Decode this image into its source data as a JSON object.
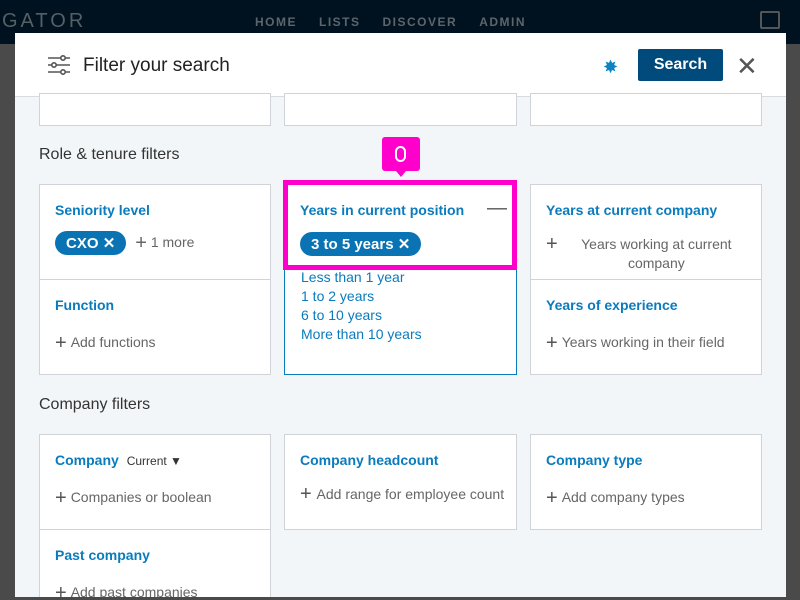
{
  "nav": {
    "brand": "GATOR",
    "links": [
      "HOME",
      "LISTS",
      "DISCOVER",
      "ADMIN"
    ]
  },
  "modal": {
    "title": "Filter your search",
    "search_label": "Search",
    "close_icon": "close-icon"
  },
  "role_section": {
    "title": "Role & tenure filters",
    "seniority": {
      "title": "Seniority level",
      "chip": "CXO",
      "more": "1 more"
    },
    "years_position": {
      "title": "Years in current position",
      "chip": "3 to 5 years",
      "options": [
        "Less than 1 year",
        "1 to 2 years",
        "6 to 10 years",
        "More than 10 years"
      ]
    },
    "years_company": {
      "title": "Years at current company",
      "placeholder": "Years working at current company"
    },
    "function": {
      "title": "Function",
      "placeholder": "Add functions"
    },
    "experience": {
      "title": "Years of experience",
      "placeholder": "Years working in their field"
    }
  },
  "company_section": {
    "title": "Company filters",
    "company": {
      "title": "Company",
      "selector": "Current",
      "placeholder": "Companies or boolean"
    },
    "headcount": {
      "title": "Company headcount",
      "placeholder": "Add range for employee count"
    },
    "type": {
      "title": "Company type",
      "placeholder": "Add company types"
    },
    "past": {
      "title": "Past company",
      "placeholder": "Add past companies"
    }
  },
  "colors": {
    "accent": "#0a7bbd",
    "button": "#004b7c",
    "highlight": "#ff00cc"
  }
}
